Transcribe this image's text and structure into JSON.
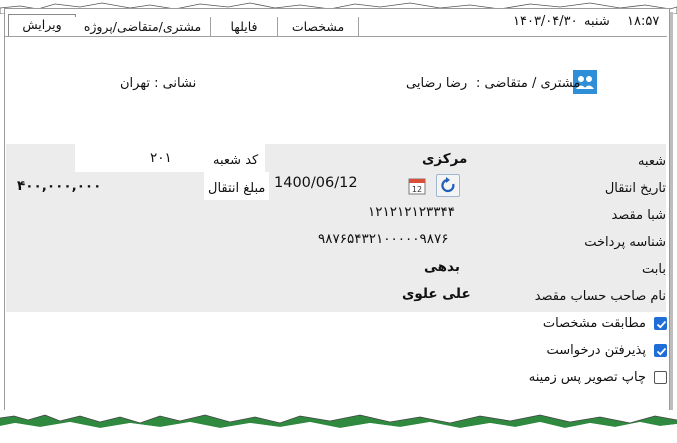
{
  "status": {
    "time": "۱۸:۵۷",
    "day": "شنبه",
    "date": "۱۴۰۳/۰۴/۳۰"
  },
  "tabs": [
    {
      "label": "ویرایش",
      "active": true
    },
    {
      "label": "مشتری/متقاضی/پروژه",
      "active": false
    },
    {
      "label": "فایلها",
      "active": false
    },
    {
      "label": "مشخصات",
      "active": false
    }
  ],
  "customer": {
    "label": "مشتری / متقاضی :",
    "name": "رضا رضایی",
    "address": "نشانی : تهران"
  },
  "form": {
    "branch_label": "شعبه",
    "branch_value": "مرکزی",
    "branch_code_label": "کد شعبه",
    "branch_code_value": "۲۰۱",
    "transfer_date_label": "تاریخ انتقال",
    "transfer_date_value": "1400/06/12",
    "amount_label": "مبلغ انتقال",
    "amount_value": "۴۰۰,۰۰۰,۰۰۰",
    "sheba_label": "شبا مقصد",
    "sheba_value": "۱۲۱۲۱۲۱۲۳۳۴۴",
    "payment_id_label": "شناسه پرداخت",
    "payment_id_value": "۹۸۷۶۵۴۳۲۱۰۰۰۰۰۹۸۷۶",
    "reason_label": "بابت",
    "reason_value": "بدهی",
    "account_owner_label": "نام صاحب حساب مقصد",
    "account_owner_value": "علی علوی"
  },
  "checkboxes": [
    {
      "label": "مطابقت مشخصات",
      "checked": true
    },
    {
      "label": "پذیرفتن درخواست",
      "checked": true
    },
    {
      "label": "چاپ تصویر پس زمینه",
      "checked": false
    }
  ],
  "colors": {
    "accent": "#1f6ed8",
    "panel": "#ececec"
  }
}
